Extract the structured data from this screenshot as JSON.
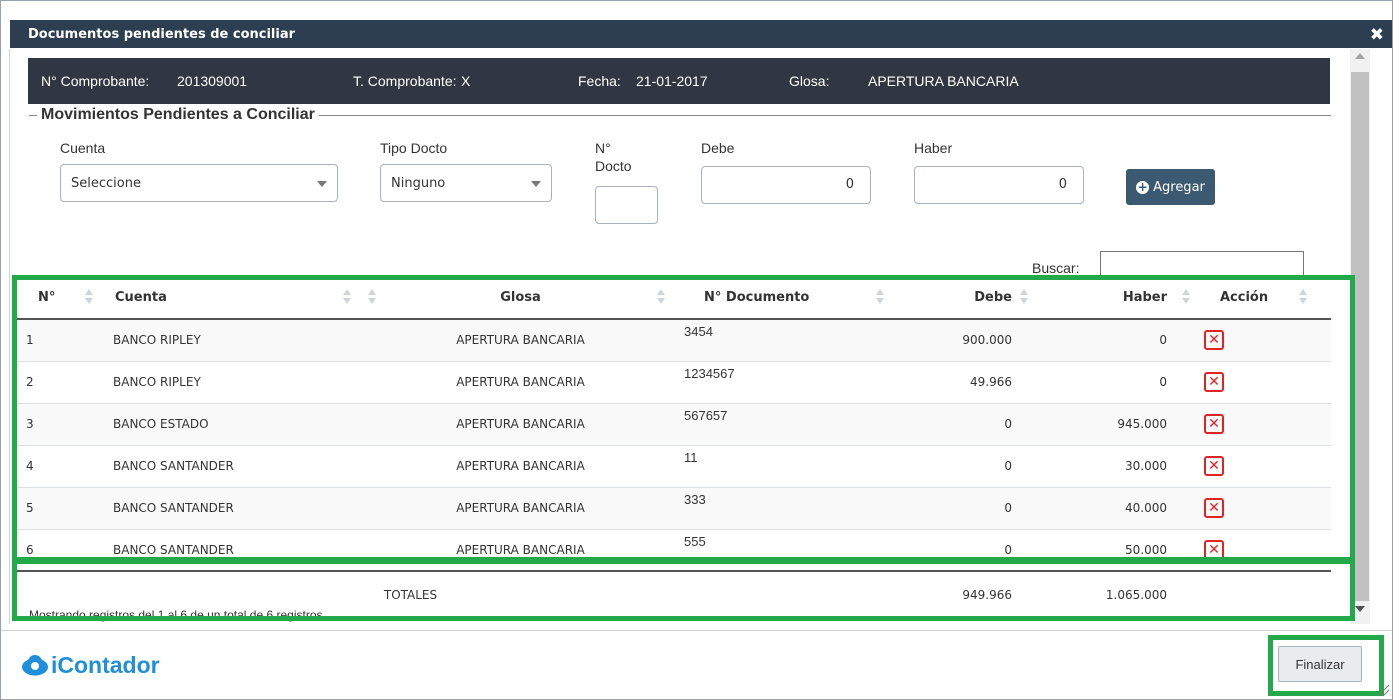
{
  "dialog": {
    "title": "Documentos pendientes de conciliar",
    "close_icon": "close-icon"
  },
  "header": {
    "comprobante_label": "N° Comprobante:",
    "comprobante_value": "201309001",
    "tipo_label": "T. Comprobante:",
    "tipo_value": "X",
    "fecha_label": "Fecha:",
    "fecha_value": "21-01-2017",
    "glosa_label": "Glosa:",
    "glosa_value": "APERTURA BANCARIA"
  },
  "form": {
    "legend": "Movimientos Pendientes a Conciliar",
    "cuenta_label": "Cuenta",
    "cuenta_value": "Seleccione",
    "tipo_docto_label": "Tipo Docto",
    "tipo_docto_value": "Ninguno",
    "ndocto_label_line1": "N°",
    "ndocto_label_line2": "Docto",
    "ndocto_value": "",
    "debe_label": "Debe",
    "debe_value": "0",
    "haber_label": "Haber",
    "haber_value": "0",
    "agregar_label": "Agregar",
    "buscar_label": "Buscar:",
    "buscar_value": ""
  },
  "table": {
    "columns": [
      "N°",
      "Cuenta",
      "Glosa",
      "N° Documento",
      "Debe",
      "Haber",
      "Acción"
    ],
    "rows": [
      {
        "n": "1",
        "cuenta": "BANCO RIPLEY",
        "glosa": "APERTURA BANCARIA",
        "documento": "3454",
        "debe": "900.000",
        "haber": "0"
      },
      {
        "n": "2",
        "cuenta": "BANCO RIPLEY",
        "glosa": "APERTURA BANCARIA",
        "documento": "1234567",
        "debe": "49.966",
        "haber": "0"
      },
      {
        "n": "3",
        "cuenta": "BANCO ESTADO",
        "glosa": "APERTURA BANCARIA",
        "documento": "567657",
        "debe": "0",
        "haber": "945.000"
      },
      {
        "n": "4",
        "cuenta": "BANCO SANTANDER",
        "glosa": "APERTURA BANCARIA",
        "documento": "11",
        "debe": "0",
        "haber": "30.000"
      },
      {
        "n": "5",
        "cuenta": "BANCO SANTANDER",
        "glosa": "APERTURA BANCARIA",
        "documento": "333",
        "debe": "0",
        "haber": "40.000"
      },
      {
        "n": "6",
        "cuenta": "BANCO SANTANDER",
        "glosa": "APERTURA BANCARIA",
        "documento": "555",
        "debe": "0",
        "haber": "50.000"
      }
    ],
    "totals_label": "TOTALES",
    "totals_debe": "949.966",
    "totals_haber": "1.065.000",
    "info": "Mostrando registros del 1 al 6 de un total de 6 registros"
  },
  "footer": {
    "logo_text": "iContador",
    "finalizar_label": "Finalizar"
  },
  "colors": {
    "title_bar": "#2c3e50",
    "info_bar": "#303742",
    "highlight": "#23a84a",
    "delete": "#e02424",
    "logo": "#1f8fdc"
  }
}
